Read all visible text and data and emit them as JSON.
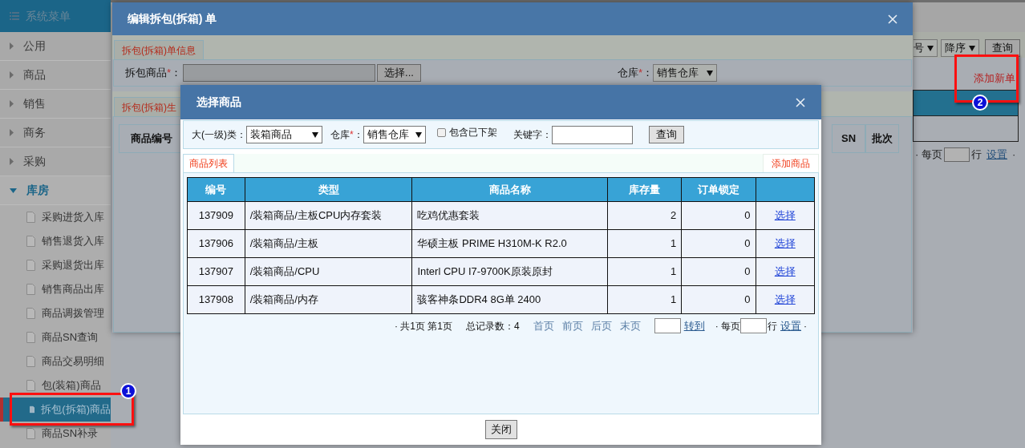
{
  "sidebar": {
    "title": "系统菜单",
    "items": [
      {
        "label": "公用",
        "expanded": false
      },
      {
        "label": "商品",
        "expanded": false
      },
      {
        "label": "销售",
        "expanded": false
      },
      {
        "label": "商务",
        "expanded": false
      },
      {
        "label": "采购",
        "expanded": false
      },
      {
        "label": "库房",
        "expanded": true,
        "children": [
          {
            "label": "采购进货入库",
            "selected": false
          },
          {
            "label": "销售退货入库",
            "selected": false
          },
          {
            "label": "采购退货出库",
            "selected": false
          },
          {
            "label": "销售商品出库",
            "selected": false
          },
          {
            "label": "商品调拨管理",
            "selected": false
          },
          {
            "label": "商品SN查询",
            "selected": false
          },
          {
            "label": "商品交易明细",
            "selected": false
          },
          {
            "label": "包(装箱)商品",
            "selected": false
          },
          {
            "label": "拆包(拆箱)商品",
            "selected": true
          },
          {
            "label": "商品SN补录",
            "selected": false
          }
        ]
      }
    ]
  },
  "background_page": {
    "sort_field": "号",
    "sort_order": "降序",
    "query_button": "查询",
    "add_link": "添加新单",
    "pagination": {
      "per_page_label": "· 每页",
      "rows_label": "行",
      "settings_link": "设置",
      "end_dot": "·"
    }
  },
  "edit_dialog": {
    "title": "编辑拆包(拆箱) 单",
    "info_tab": "拆包(拆箱)单信息",
    "product_label": "拆包商品",
    "product_required_mark": "*",
    "product_colon": "：",
    "choose_button": "选择...",
    "warehouse_label": "仓库",
    "warehouse_required_mark": "*",
    "warehouse_colon": "：",
    "warehouse": "销售仓库",
    "items_tab": "拆包(拆箱)生",
    "columns": [
      "商品编号",
      "SN",
      "批次"
    ]
  },
  "select_dialog": {
    "title": "选择商品",
    "category_label": "大(一级)类：",
    "category": "装箱商品",
    "warehouse_label": "仓库",
    "warehouse_required_mark": "*",
    "warehouse_colon": "：",
    "warehouse": "销售仓库",
    "include_delisted": {
      "label": "包含已下架",
      "checked": false
    },
    "keyword_label": "关键字：",
    "query_button": "查询",
    "list_tab": {
      "label": "商品列表",
      "selected": true
    },
    "add_link": "添加商品",
    "table": {
      "columns": [
        "编号",
        "类型",
        "商品名称",
        "库存量",
        "订单锁定"
      ],
      "rows": [
        {
          "id": "137909",
          "type": "/装箱商品/主板CPU内存套装",
          "name": "吃鸡优惠套装",
          "stock": "2",
          "locked": "0",
          "action": "选择"
        },
        {
          "id": "137906",
          "type": "/装箱商品/主板",
          "name": "华硕主板 PRIME H310M-K R2.0",
          "stock": "1",
          "locked": "0",
          "action": "选择"
        },
        {
          "id": "137907",
          "type": "/装箱商品/CPU",
          "name": "Interl CPU I7-9700K原装原封",
          "stock": "1",
          "locked": "0",
          "action": "选择"
        },
        {
          "id": "137908",
          "type": "/装箱商品/内存",
          "name": "骇客神条DDR4 8G单 2400",
          "stock": "1",
          "locked": "0",
          "action": "选择"
        }
      ]
    },
    "pagination": {
      "pages": "· 共1页 第1页",
      "total": "总记录数：4",
      "links": [
        "首页",
        "前页",
        "后页",
        "末页"
      ],
      "goto_link": "转到",
      "per_page_label": "· 每页",
      "rows_label": "行",
      "settings_link": "设置",
      "end_dot": "·"
    },
    "close_button": "关闭"
  },
  "annotations": [
    {
      "number": "1"
    },
    {
      "number": "2"
    }
  ]
}
